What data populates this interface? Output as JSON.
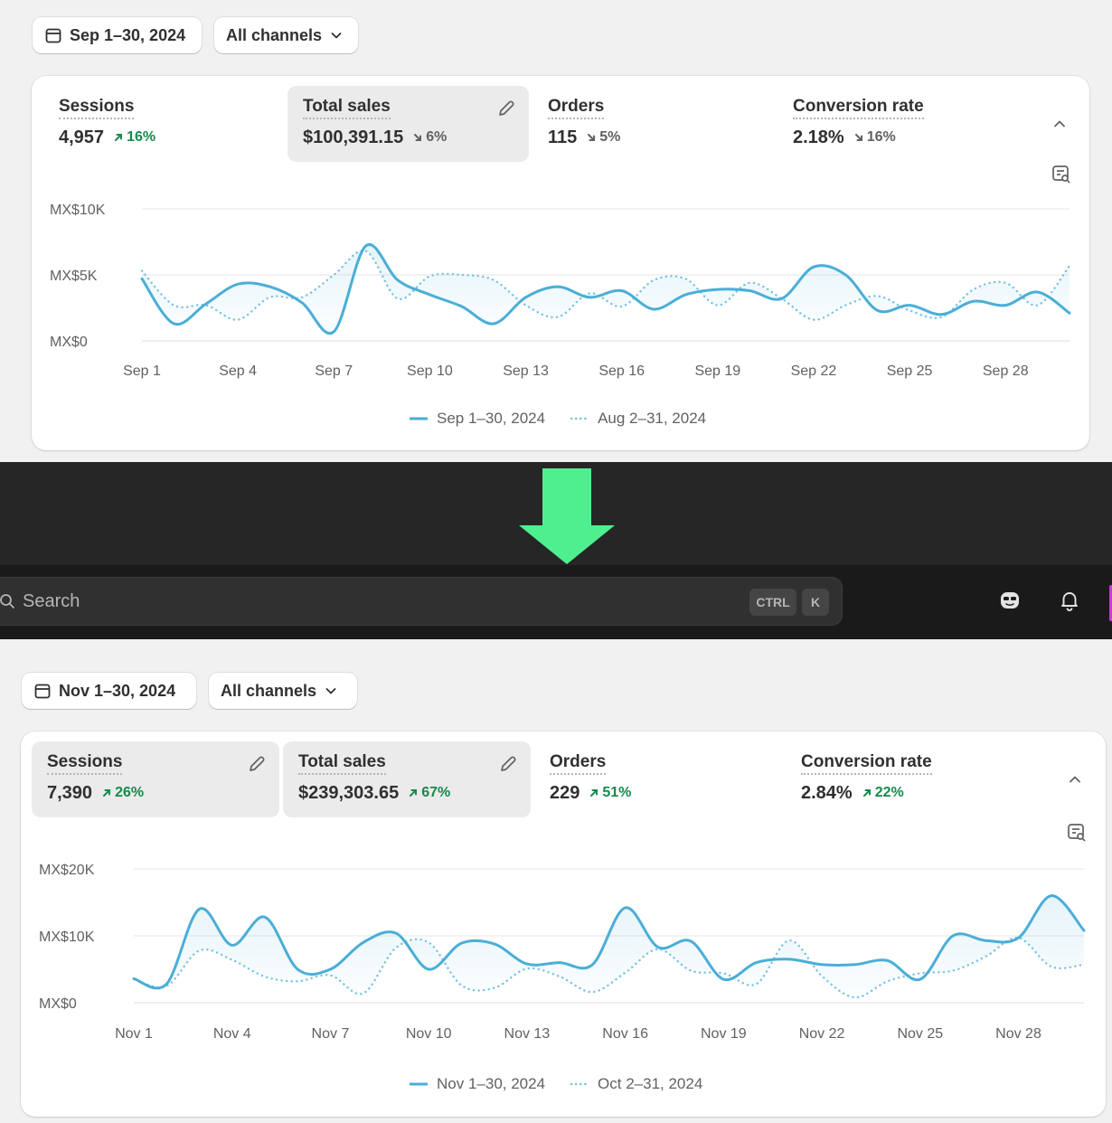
{
  "colors": {
    "primary_line": "#4aaed7",
    "compare_line": "#76c2e2",
    "up": "#178a4a",
    "down": "#616161",
    "arrow": "#4fef8f"
  },
  "top": {
    "date_range": "Sep 1–30, 2024",
    "channel_filter": "All channels",
    "metrics": [
      {
        "label": "Sessions",
        "value": "4,957",
        "change": "16%",
        "direction": "up"
      },
      {
        "label": "Total sales",
        "value": "$100,391.15",
        "change": "6%",
        "direction": "down"
      },
      {
        "label": "Orders",
        "value": "115",
        "change": "5%",
        "direction": "down"
      },
      {
        "label": "Conversion rate",
        "value": "2.18%",
        "change": "16%",
        "direction": "down"
      }
    ],
    "legend": {
      "current": "Sep 1–30, 2024",
      "previous": "Aug 2–31, 2024"
    }
  },
  "topbar": {
    "search_placeholder": "Search",
    "shortcut_ctrl": "CTRL",
    "shortcut_key": "K"
  },
  "bottom": {
    "date_range": "Nov 1–30, 2024",
    "channel_filter": "All channels",
    "metrics": [
      {
        "label": "Sessions",
        "value": "7,390",
        "change": "26%",
        "direction": "up"
      },
      {
        "label": "Total sales",
        "value": "$239,303.65",
        "change": "67%",
        "direction": "up"
      },
      {
        "label": "Orders",
        "value": "229",
        "change": "51%",
        "direction": "up"
      },
      {
        "label": "Conversion rate",
        "value": "2.84%",
        "change": "22%",
        "direction": "up"
      }
    ],
    "legend": {
      "current": "Nov 1–30, 2024",
      "previous": "Oct 2–31, 2024"
    }
  },
  "chart_data": [
    {
      "type": "line",
      "title": "",
      "y_tick_labels": [
        "MX$0",
        "MX$5K",
        "MX$10K"
      ],
      "y_ticks": [
        0,
        5000,
        10000
      ],
      "ylim": [
        0,
        10000
      ],
      "x_tick_labels": [
        "Sep 1",
        "Sep 4",
        "Sep 7",
        "Sep 10",
        "Sep 13",
        "Sep 16",
        "Sep 19",
        "Sep 22",
        "Sep 25",
        "Sep 28"
      ],
      "x_tick_days": [
        1,
        4,
        7,
        10,
        13,
        16,
        19,
        22,
        25,
        28
      ],
      "x_range": [
        1,
        30
      ],
      "grid": true,
      "legend_position": "bottom",
      "series": [
        {
          "name": "Sep 1–30, 2024",
          "style": "solid",
          "x": [
            1,
            2,
            3,
            4,
            5,
            6,
            7,
            8,
            9,
            10,
            11,
            12,
            13,
            14,
            15,
            16,
            17,
            18,
            19,
            20,
            21,
            22,
            23,
            24,
            25,
            26,
            27,
            28,
            29,
            30
          ],
          "values": [
            4700,
            1300,
            2800,
            4300,
            4100,
            2900,
            700,
            7200,
            4600,
            3500,
            2600,
            1300,
            3300,
            4100,
            3300,
            3800,
            2400,
            3500,
            3900,
            3800,
            3200,
            5600,
            5000,
            2300,
            2700,
            2000,
            3000,
            2700,
            3700,
            2100
          ]
        },
        {
          "name": "Aug 2–31, 2024",
          "style": "dotted",
          "x": [
            1,
            2,
            3,
            4,
            5,
            6,
            7,
            8,
            9,
            10,
            11,
            12,
            13,
            14,
            15,
            16,
            17,
            18,
            19,
            20,
            21,
            22,
            23,
            24,
            25,
            26,
            27,
            28,
            29,
            30
          ],
          "values": [
            5300,
            2700,
            2700,
            1600,
            3300,
            3300,
            5000,
            6800,
            3200,
            4900,
            5000,
            4600,
            2700,
            1800,
            3600,
            2600,
            4600,
            4700,
            2700,
            4400,
            3200,
            1600,
            2700,
            3400,
            2300,
            1800,
            3900,
            4400,
            2700,
            5700
          ]
        }
      ]
    },
    {
      "type": "line",
      "title": "",
      "y_tick_labels": [
        "MX$0",
        "MX$10K",
        "MX$20K"
      ],
      "y_ticks": [
        0,
        10000,
        20000
      ],
      "ylim": [
        0,
        20000
      ],
      "x_tick_labels": [
        "Nov 1",
        "Nov 4",
        "Nov 7",
        "Nov 10",
        "Nov 13",
        "Nov 16",
        "Nov 19",
        "Nov 22",
        "Nov 25",
        "Nov 28"
      ],
      "x_tick_days": [
        1,
        4,
        7,
        10,
        13,
        16,
        19,
        22,
        25,
        28
      ],
      "x_range": [
        1,
        30
      ],
      "grid": true,
      "legend_position": "bottom",
      "series": [
        {
          "name": "Nov 1–30, 2024",
          "style": "solid",
          "x": [
            1,
            2,
            3,
            4,
            5,
            6,
            7,
            8,
            9,
            10,
            11,
            12,
            13,
            14,
            15,
            16,
            17,
            18,
            19,
            20,
            21,
            22,
            23,
            24,
            25,
            26,
            27,
            28,
            29,
            30
          ],
          "values": [
            3600,
            2800,
            14000,
            8600,
            12800,
            5000,
            5000,
            9000,
            10400,
            5000,
            8900,
            8800,
            5800,
            6000,
            5700,
            14200,
            8300,
            9200,
            3500,
            6000,
            6500,
            5700,
            5700,
            6300,
            3500,
            10000,
            9300,
            9700,
            16000,
            10800
          ]
        },
        {
          "name": "Oct 2–31, 2024",
          "style": "dotted",
          "x": [
            1,
            2,
            3,
            4,
            5,
            6,
            7,
            8,
            9,
            10,
            11,
            12,
            13,
            14,
            15,
            16,
            17,
            18,
            19,
            20,
            21,
            22,
            23,
            24,
            25,
            26,
            27,
            28,
            29,
            30
          ],
          "values": [
            3500,
            2500,
            7800,
            6400,
            3900,
            3200,
            4100,
            1400,
            8200,
            9000,
            2600,
            2200,
            5100,
            3900,
            1600,
            4500,
            8000,
            4800,
            4400,
            2800,
            9300,
            4000,
            800,
            3200,
            4400,
            4800,
            6900,
            9700,
            5400,
            5700
          ]
        }
      ]
    }
  ]
}
